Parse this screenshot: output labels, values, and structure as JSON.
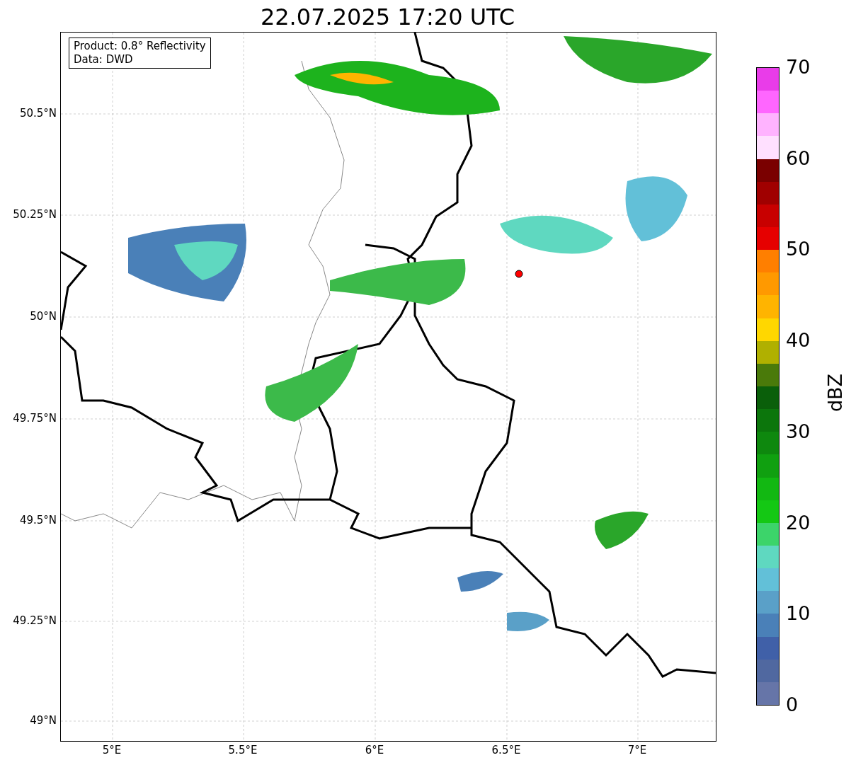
{
  "title": "22.07.2025 17:20 UTC",
  "legend": {
    "lines": [
      "Product: 0.8° Reflectivity",
      "Data: DWD"
    ]
  },
  "y_ticks": [
    "50.5°N",
    "50.25°N",
    "50°N",
    "49.75°N",
    "49.5°N",
    "49.25°N",
    "49°N"
  ],
  "x_ticks": [
    "5°E",
    "5.5°E",
    "6°E",
    "6.5°E",
    "7°E"
  ],
  "colorbar": {
    "label": "dBZ",
    "ticks": [
      "70",
      "60",
      "50",
      "40",
      "30",
      "20",
      "10",
      "0"
    ],
    "segments": [
      {
        "color": "#6675a8"
      },
      {
        "color": "#5068a0"
      },
      {
        "color": "#4060a8"
      },
      {
        "color": "#4a80b8"
      },
      {
        "color": "#5aa0c8"
      },
      {
        "color": "#62c0d8"
      },
      {
        "color": "#5fd8c0"
      },
      {
        "color": "#3cd46a"
      },
      {
        "color": "#14c814"
      },
      {
        "color": "#12b812"
      },
      {
        "color": "#10a010"
      },
      {
        "color": "#0e880e"
      },
      {
        "color": "#0c760c"
      },
      {
        "color": "#0a5f0a"
      },
      {
        "color": "#4a7a0a"
      },
      {
        "color": "#b0b000"
      },
      {
        "color": "#ffd700"
      },
      {
        "color": "#ffb400"
      },
      {
        "color": "#ff9900"
      },
      {
        "color": "#ff7f00"
      },
      {
        "color": "#e60000"
      },
      {
        "color": "#c80000"
      },
      {
        "color": "#a00000"
      },
      {
        "color": "#7a0000"
      },
      {
        "color": "#ffe0ff"
      },
      {
        "color": "#ffb3ff"
      },
      {
        "color": "#ff66ff"
      },
      {
        "color": "#e93ce9"
      }
    ]
  }
}
